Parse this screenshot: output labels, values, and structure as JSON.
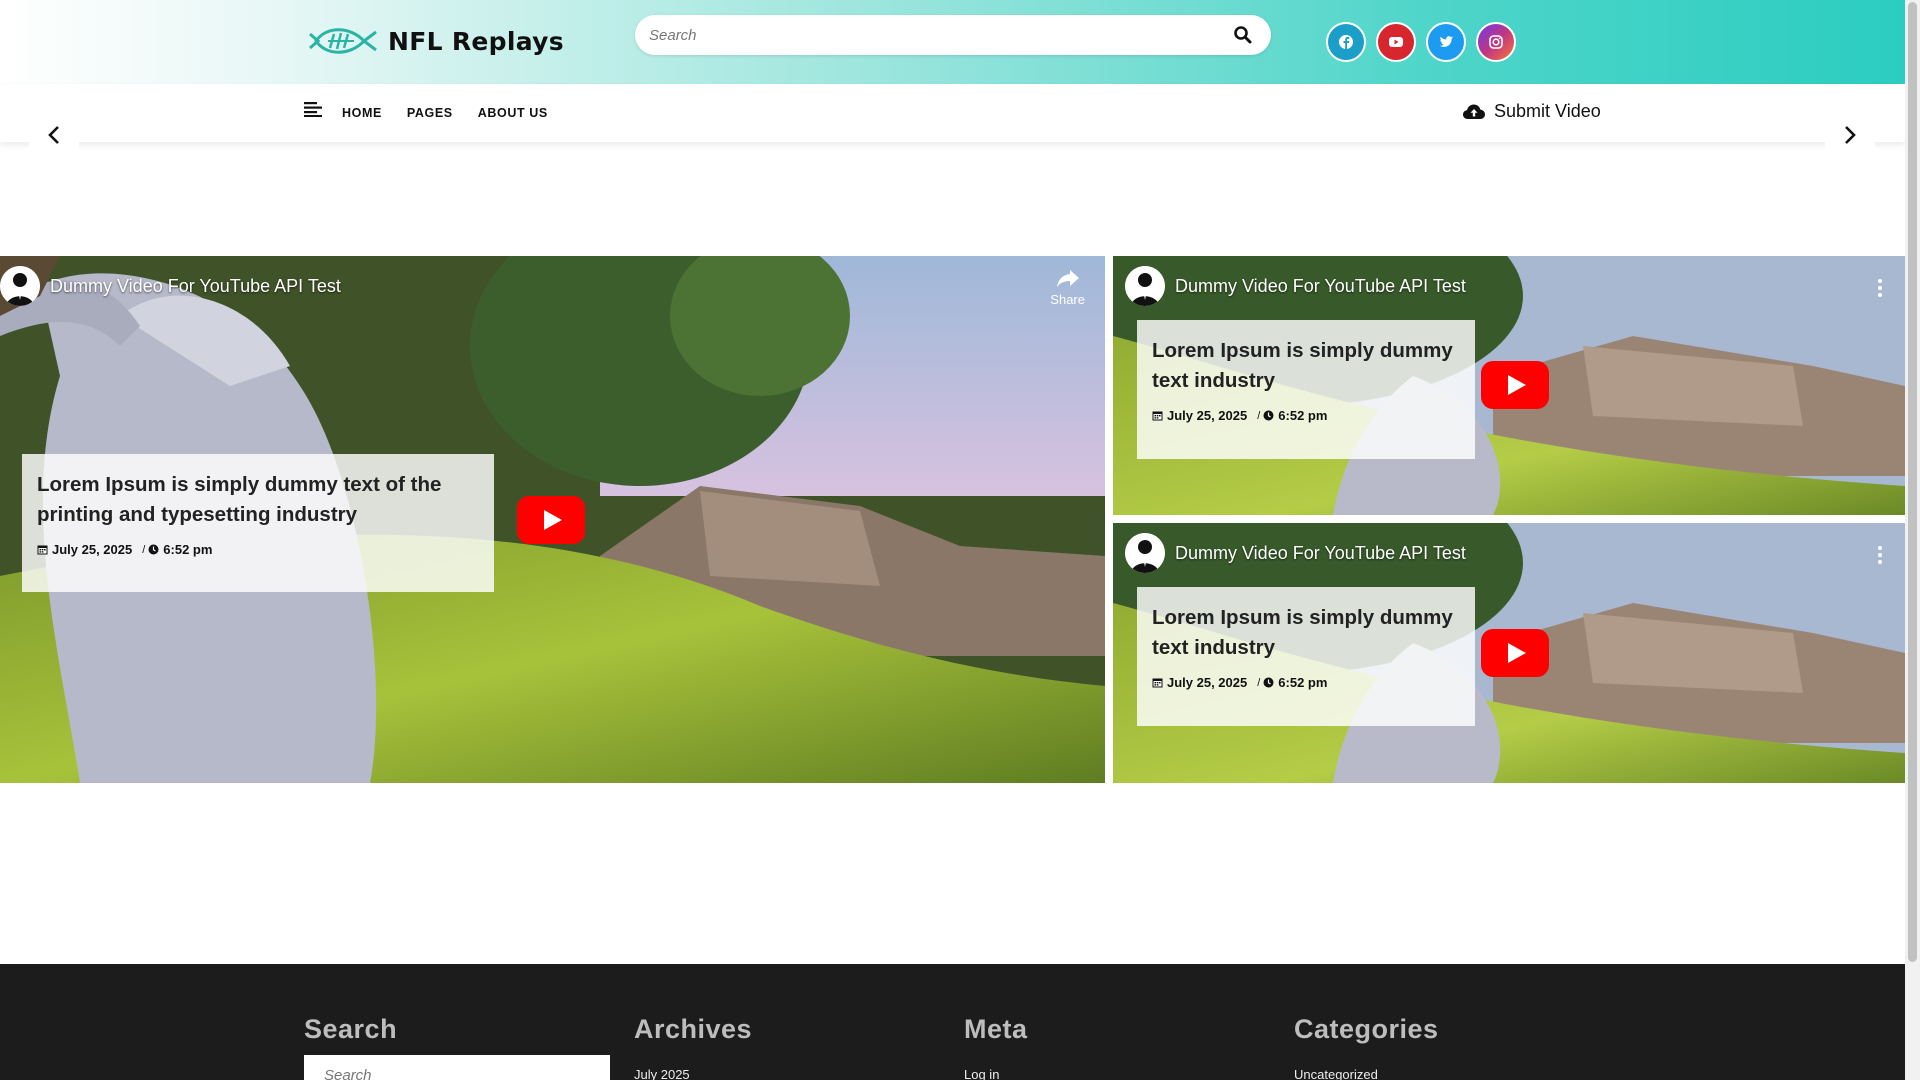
{
  "header": {
    "logo_text": "NFL Replays",
    "search_placeholder": "Search",
    "socials": [
      "facebook-icon",
      "youtube-icon",
      "twitter-icon",
      "instagram-icon"
    ]
  },
  "nav": {
    "items": [
      {
        "label": "HOME"
      },
      {
        "label": "PAGES"
      },
      {
        "label": "ABOUT US"
      }
    ],
    "submit_label": "Submit Video"
  },
  "videos": [
    {
      "channel_title": "Dummy Video For YouTube API Test",
      "share_label": "Share",
      "post_title": "Lorem Ipsum is simply dummy text of the printing and typesetting industry",
      "date": "July 25, 2025",
      "separator": "/",
      "time": "6:52 pm"
    },
    {
      "channel_title": "Dummy Video For YouTube API Test",
      "post_title": "Lorem Ipsum is simply dummy text industry",
      "date": "July 25, 2025",
      "separator": "/",
      "time": "6:52 pm"
    },
    {
      "channel_title": "Dummy Video For YouTube API Test",
      "post_title": "Lorem Ipsum is simply dummy text industry",
      "date": "July 25, 2025",
      "separator": "/",
      "time": "6:52 pm"
    }
  ],
  "footer": {
    "search": {
      "heading": "Search",
      "placeholder": "Search"
    },
    "archives": {
      "heading": "Archives",
      "items": [
        "July 2025"
      ]
    },
    "meta": {
      "heading": "Meta",
      "items": [
        "Log in"
      ]
    },
    "categories": {
      "heading": "Categories",
      "items": [
        "Uncategorized"
      ]
    }
  },
  "colors": {
    "youtube_red": "#ff0000",
    "footer_bg": "#1c1c1c"
  }
}
